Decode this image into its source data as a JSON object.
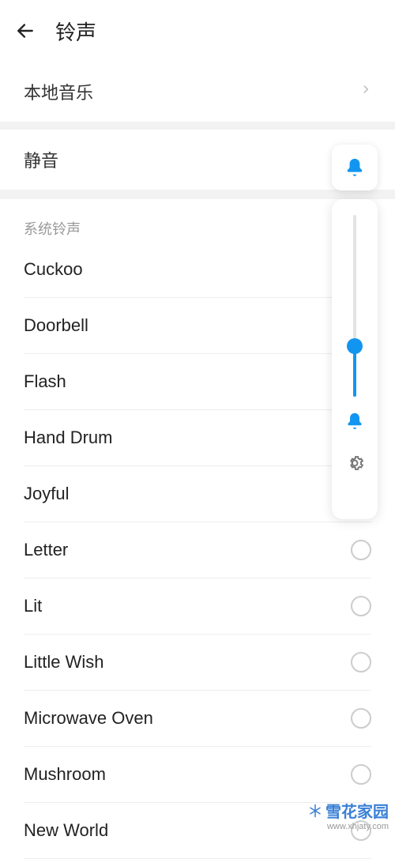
{
  "header": {
    "title": "铃声"
  },
  "local": {
    "label": "本地音乐"
  },
  "mute": {
    "label": "静音"
  },
  "category": {
    "label": "系统铃声"
  },
  "ringtones": [
    {
      "label": "Cuckoo",
      "showRadio": false
    },
    {
      "label": "Doorbell",
      "showRadio": false
    },
    {
      "label": "Flash",
      "showRadio": false
    },
    {
      "label": "Hand Drum",
      "showRadio": false
    },
    {
      "label": "Joyful",
      "showRadio": false
    },
    {
      "label": "Letter",
      "showRadio": true
    },
    {
      "label": "Lit",
      "showRadio": true
    },
    {
      "label": "Little Wish",
      "showRadio": true
    },
    {
      "label": "Microwave Oven",
      "showRadio": true
    },
    {
      "label": "Mushroom",
      "showRadio": true
    },
    {
      "label": "New World",
      "showRadio": true
    }
  ],
  "watermark": {
    "line1": "雪花家园",
    "line2": "www.xhjaty.com"
  }
}
